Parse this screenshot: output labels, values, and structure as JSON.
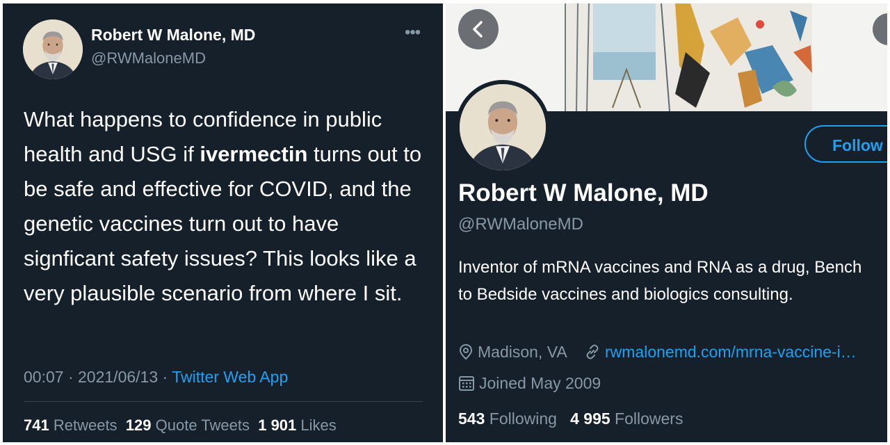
{
  "tweet": {
    "author_name": "Robert W Malone, MD",
    "author_handle": "@RWMaloneMD",
    "more_icon": "more-horizontal-icon",
    "text_before": "What happens to confidence in public health and USG if ",
    "text_bold": "ivermectin",
    "text_after": " turns out to be safe and effective for COVID, and the genetic vaccines turn out to have signficant safety issues?  This looks like a very plausible scenario from where I sit.",
    "time": "00:07",
    "date": "2021/06/13",
    "separator": "·",
    "source_app": "Twitter Web App",
    "stats": {
      "retweets_count": "741",
      "retweets_label": "Retweets",
      "quote_tweets_count": "129",
      "quote_tweets_label": "Quote Tweets",
      "likes_count": "1 901",
      "likes_label": "Likes"
    }
  },
  "profile": {
    "back_icon": "chevron-left-icon",
    "follow_label": "Follow",
    "name": "Robert W Malone, MD",
    "handle": "@RWMaloneMD",
    "bio": "Inventor of mRNA vaccines and RNA as a drug, Bench to Bedside vaccines and biologics consulting.",
    "location": "Madison, VA",
    "website": "rwmalonemd.com/mrna-vaccine-i…",
    "joined": "Joined May 2009",
    "following_count": "543",
    "following_label": "Following",
    "followers_count": "4 995",
    "followers_label": "Followers"
  },
  "colors": {
    "background": "#15202b",
    "text_primary": "#ffffff",
    "text_secondary": "#8899a6",
    "accent": "#1da1f2"
  }
}
